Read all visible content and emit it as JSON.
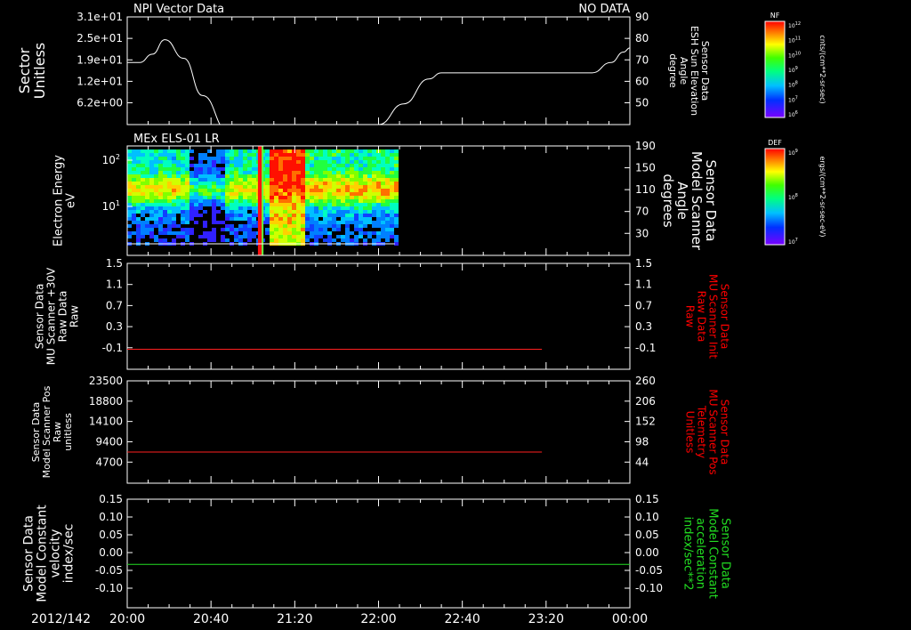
{
  "date": "2012/142",
  "time_ticks": [
    "20:00",
    "20:40",
    "21:20",
    "22:00",
    "22:40",
    "23:20",
    "00:00"
  ],
  "colors": {
    "frame": "#ffffff",
    "red_trace": "#ff2020",
    "green_trace": "#22dd22",
    "red_label": "#ff0000",
    "green_label": "#22dd22"
  },
  "chart_data": [
    {
      "type": "line",
      "panel": "sector",
      "title": "NPI Vector Data",
      "status": "NO DATA",
      "ylabel": [
        "Sector",
        "Unitless"
      ],
      "ylabel_right": [
        "Sensor Data",
        "ESH Sun Elevation",
        "Angle",
        "degree"
      ],
      "yticks_left": [
        "3.1e+01",
        "2.5e+01",
        "1.9e+01",
        "1.2e+01",
        "6.2e+00"
      ],
      "yticks_right": [
        "90",
        "80",
        "70",
        "60",
        "50"
      ],
      "ylim_right": [
        38,
        90
      ],
      "x_hours": [
        0,
        0.1,
        0.2,
        0.3,
        0.45,
        0.6,
        0.8,
        1.2,
        1.6,
        2.0,
        2.2,
        2.4,
        2.5,
        2.6,
        3.0,
        3.5,
        3.7,
        3.85,
        3.95,
        4.0
      ],
      "y_values": [
        68,
        68,
        72,
        79,
        70,
        52,
        35,
        30,
        30,
        38,
        48,
        60,
        63,
        63,
        63,
        63,
        63,
        68,
        73,
        75
      ]
    },
    {
      "type": "heatmap",
      "panel": "els",
      "title": "MEx ELS-01 LR",
      "ylabel": [
        "Electron Energy",
        "eV"
      ],
      "ylabel_right": [
        "Sensor Data",
        "Model Scanner",
        "Angle",
        "degrees"
      ],
      "yticks_left": [
        "10^2",
        "10^1"
      ],
      "yticks_right": [
        "190",
        "150",
        "110",
        "70",
        "30"
      ],
      "data_end_hours": 2.13,
      "colorbar_label": "DEF",
      "colorbar_units": "ergs/(cm**2-sr-sec-eV)",
      "colorbar_ticks": [
        "10^9",
        "10^8",
        "10^7"
      ]
    },
    {
      "type": "line",
      "panel": "raw30v",
      "ylabel": [
        "Sensor Data",
        "MU Scanner +30V",
        "Raw Data",
        "Raw"
      ],
      "ylabel_right": [
        "Sensor Data",
        "MU Scanner Init",
        "Raw Data",
        "Raw"
      ],
      "yticks_left": [
        "1.5",
        "1.1",
        "0.7",
        "0.3",
        "-0.1"
      ],
      "yticks_right": [
        "1.5",
        "1.1",
        "0.7",
        "0.3",
        "-0.1"
      ],
      "ylim": [
        -0.35,
        1.5
      ],
      "series": [
        {
          "x_hours": [
            0,
            3.3
          ],
          "values": [
            0.0,
            0.0
          ]
        }
      ]
    },
    {
      "type": "line",
      "panel": "scannerpos",
      "ylabel": [
        "Sensor Data",
        "Model Scanner Pos",
        "Raw",
        "unitless"
      ],
      "ylabel_right": [
        "Sensor Data",
        "MU Scanner Pos",
        "Telemetry",
        "Unitless"
      ],
      "yticks_left": [
        "23500",
        "18800",
        "14100",
        "9400",
        "4700"
      ],
      "yticks_right": [
        "260",
        "206",
        "152",
        "98",
        "44"
      ],
      "ylim": [
        500,
        23500
      ],
      "series": [
        {
          "x_hours": [
            0,
            3.3
          ],
          "values": [
            7500,
            7500
          ]
        }
      ]
    },
    {
      "type": "line",
      "panel": "velocity",
      "ylabel": [
        "Sensor Data",
        "Model Constant",
        "velocity",
        "index/sec"
      ],
      "ylabel_right": [
        "Sensor Data",
        "Model Constant",
        "acceleration",
        "index/sec**2"
      ],
      "yticks_left": [
        "0.15",
        "0.10",
        "0.05",
        "0.00",
        "-0.05",
        "-0.10"
      ],
      "yticks_right": [
        "0.15",
        "0.10",
        "0.05",
        "0.00",
        "-0.05",
        "-0.10"
      ],
      "ylim": [
        -0.1,
        0.15
      ],
      "series": [
        {
          "x_hours": [
            0,
            4
          ],
          "values": [
            0,
            0
          ]
        }
      ]
    }
  ],
  "colorbar_nf": {
    "label": "NF",
    "units": "cnts/(cm**2-sr-sec)",
    "ticks": [
      "10^12",
      "10^11",
      "10^10",
      "10^9",
      "10^8",
      "10^7",
      "10^6"
    ]
  }
}
